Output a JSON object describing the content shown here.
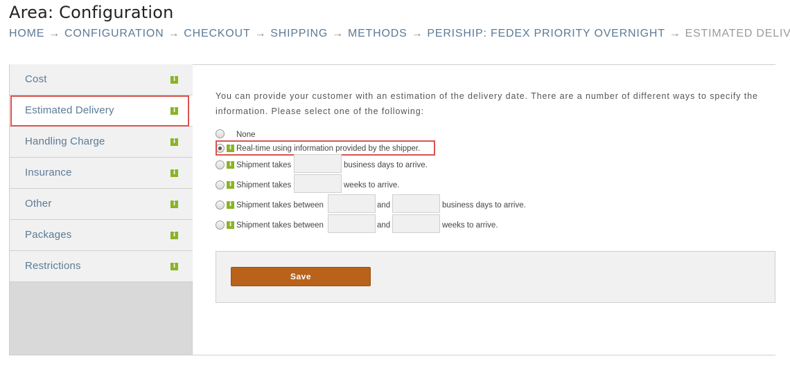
{
  "page": {
    "title": "Area: Configuration"
  },
  "breadcrumb": [
    {
      "label": "HOME"
    },
    {
      "label": "CONFIGURATION"
    },
    {
      "label": "CHECKOUT"
    },
    {
      "label": "SHIPPING"
    },
    {
      "label": "METHODS"
    },
    {
      "label": "PERISHIP: FEDEX PRIORITY OVERNIGHT"
    },
    {
      "label": "ESTIMATED DELIVERY"
    }
  ],
  "breadcrumb_separator": "→",
  "sidebar": {
    "items": [
      {
        "label": "Cost"
      },
      {
        "label": "Estimated Delivery",
        "active": true
      },
      {
        "label": "Handling Charge"
      },
      {
        "label": "Insurance"
      },
      {
        "label": "Other"
      },
      {
        "label": "Packages"
      },
      {
        "label": "Restrictions"
      }
    ],
    "info_glyph": "i"
  },
  "main": {
    "intro": "You can provide your customer with an estimation of the delivery date. There are a number of different ways to specify the information. Please select one of the following:",
    "options": {
      "none": {
        "label": "None",
        "checked": false
      },
      "realtime": {
        "label": "Real-time using information provided by the shipper.",
        "checked": true
      },
      "days": {
        "prefix": "Shipment takes",
        "suffix": "business days to arrive.",
        "value": ""
      },
      "weeks": {
        "prefix": "Shipment takes",
        "suffix": "weeks to arrive.",
        "value": ""
      },
      "days_between": {
        "prefix": "Shipment takes between",
        "and": "and",
        "suffix": "business days to arrive.",
        "from": "",
        "to": ""
      },
      "weeks_between": {
        "prefix": "Shipment takes between",
        "and": "and",
        "suffix": "weeks to arrive.",
        "from": "",
        "to": ""
      }
    },
    "save_label": "Save"
  },
  "colors": {
    "accent_link": "#5b7a96",
    "info_badge": "#8bb326",
    "save_button": "#b8621b",
    "highlight": "#d9534f"
  }
}
